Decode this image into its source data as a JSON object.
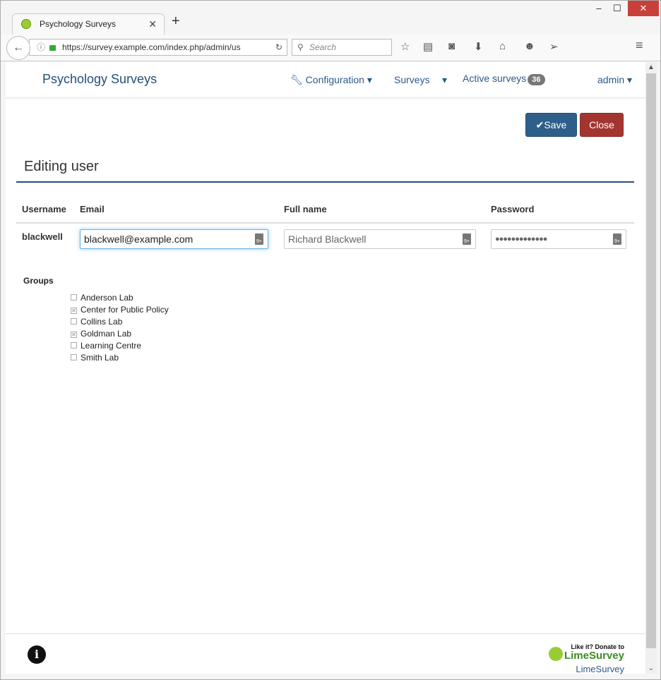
{
  "browser": {
    "tab_title": "Psychology Surveys",
    "url": "https://survey.example.com/index.php/admin/us",
    "search_placeholder": "Search"
  },
  "nav": {
    "brand": "Psychology Surveys",
    "configuration": "Configuration",
    "surveys": "Surveys",
    "active_surveys": "Active surveys",
    "active_count": "36",
    "user": "admin"
  },
  "actions": {
    "save": "Save",
    "close": "Close"
  },
  "page_title": "Editing user",
  "table": {
    "headers": [
      "Username",
      "Email",
      "Full name",
      "Password"
    ],
    "username": "blackwell",
    "email": "blackwell@example.com",
    "full_name": "Richard Blackwell",
    "password": "●●●●●●●●●●●●●"
  },
  "groups": {
    "label": "Groups",
    "items": [
      {
        "name": "Anderson Lab",
        "checked": false
      },
      {
        "name": "Center for Public Policy",
        "checked": true
      },
      {
        "name": "Collins Lab",
        "checked": false
      },
      {
        "name": "Goldman Lab",
        "checked": true
      },
      {
        "name": "Learning Centre",
        "checked": false
      },
      {
        "name": "Smith Lab",
        "checked": false
      }
    ]
  },
  "footer": {
    "donate_line1": "Like it? Donate to",
    "donate_line2": "LimeSurvey",
    "link": "LimeSurvey"
  }
}
